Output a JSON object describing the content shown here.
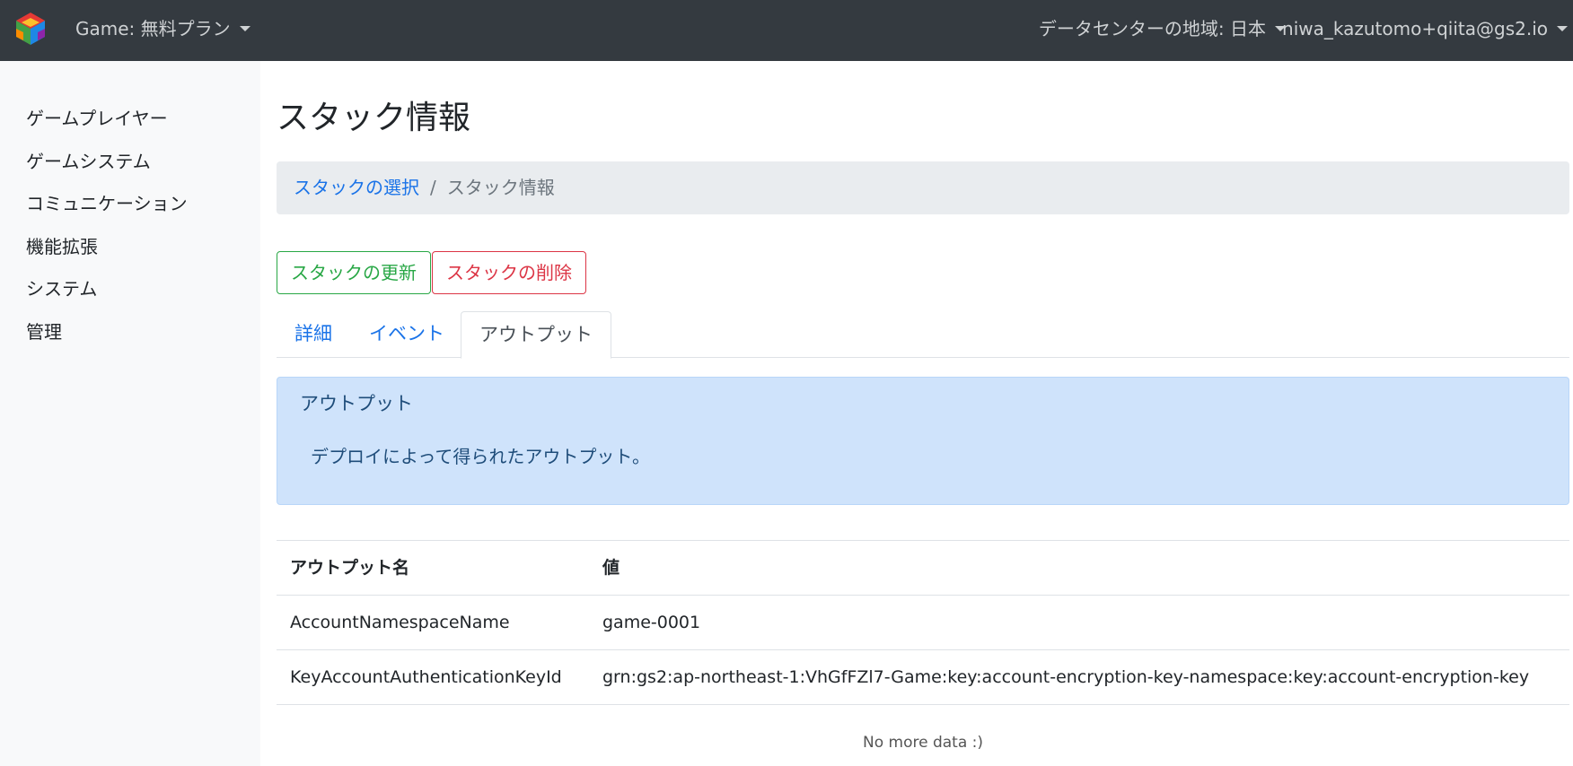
{
  "navbar": {
    "project_label": "Game: 無料プラン",
    "region_label": "データセンターの地域: 日本",
    "user_label": "niwa_kazutomo+qiita@gs2.io"
  },
  "sidebar": {
    "items": [
      {
        "label": "ゲームプレイヤー"
      },
      {
        "label": "ゲームシステム"
      },
      {
        "label": "コミュニケーション"
      },
      {
        "label": "機能拡張"
      },
      {
        "label": "システム"
      },
      {
        "label": "管理"
      }
    ]
  },
  "main": {
    "title": "スタック情報",
    "breadcrumb": {
      "link": "スタックの選択",
      "separator": "/",
      "current": "スタック情報"
    },
    "buttons": {
      "update": "スタックの更新",
      "delete": "スタックの削除"
    },
    "tabs": [
      {
        "label": "詳細"
      },
      {
        "label": "イベント"
      },
      {
        "label": "アウトプット",
        "active": true
      }
    ],
    "alert": {
      "title": "アウトプット",
      "body": "デプロイによって得られたアウトプット。"
    },
    "table": {
      "headers": {
        "name": "アウトプット名",
        "value": "値"
      },
      "rows": [
        {
          "name": "AccountNamespaceName",
          "value": "game-0001"
        },
        {
          "name": "KeyAccountAuthenticationKeyId",
          "value": "grn:gs2:ap-northeast-1:VhGfFZl7-Game:key:account-encryption-key-namespace:key:account-encryption-key"
        }
      ]
    },
    "footer_text": "No more data :)"
  },
  "colors": {
    "navbar_bg": "#343a40",
    "link": "#1a73e8",
    "success": "#28a745",
    "danger": "#dc3545",
    "alert_bg": "#cfe3fb"
  }
}
